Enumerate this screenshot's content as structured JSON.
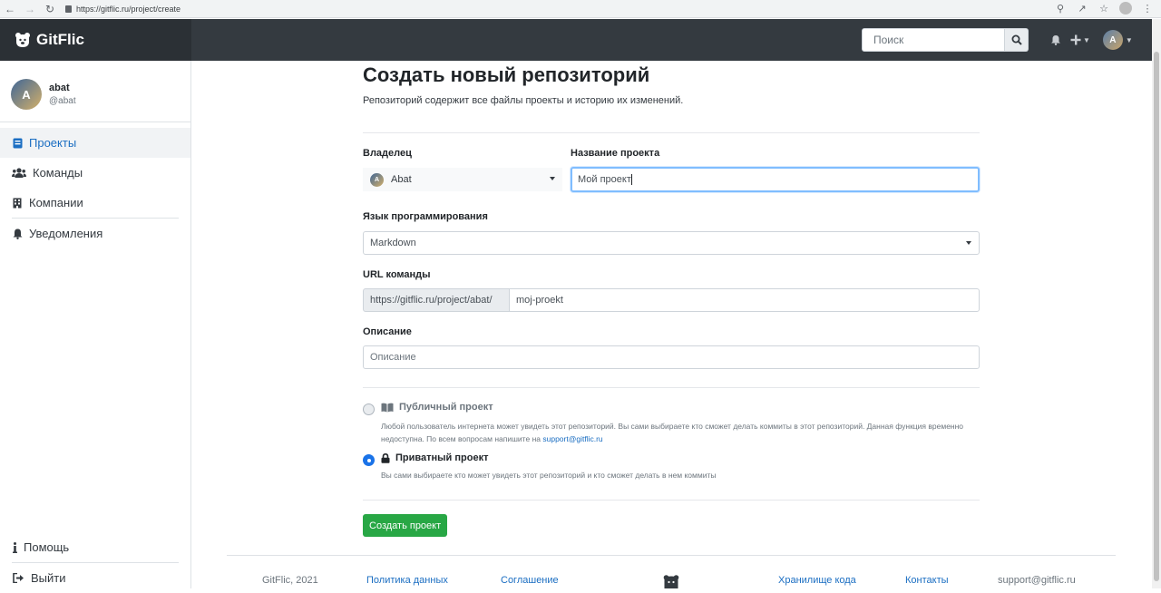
{
  "browser": {
    "url": "https://gitflic.ru/project/create"
  },
  "header": {
    "brand": "GitFlic",
    "search_placeholder": "Поиск"
  },
  "sidebar": {
    "user_name": "abat",
    "user_handle": "@abat",
    "avatar_letter": "A",
    "items": [
      {
        "label": "Проекты",
        "icon": "book-icon"
      },
      {
        "label": "Команды",
        "icon": "users-icon"
      },
      {
        "label": "Компании",
        "icon": "building-icon"
      },
      {
        "label": "Уведомления",
        "icon": "bell-icon"
      }
    ],
    "bottom": [
      {
        "label": "Помощь",
        "icon": "info-icon"
      },
      {
        "label": "Выйти",
        "icon": "sign-out-icon"
      }
    ]
  },
  "form": {
    "title": "Создать новый репозиторий",
    "subtitle": "Репозиторий содержит все файлы проекты и историю их изменений.",
    "owner_label": "Владелец",
    "owner_value": "Abat",
    "name_label": "Название проекта",
    "name_value": "Мой проект",
    "lang_label": "Язык программирования",
    "lang_value": "Markdown",
    "url_label": "URL команды",
    "url_prefix": "https://gitflic.ru/project/abat/",
    "url_value": "moj-proekt",
    "desc_label": "Описание",
    "desc_placeholder": "Описание",
    "public_title": "Публичный проект",
    "public_desc": "Любой пользователь интернета может увидеть этот репозиторий. Вы сами выбираете кто сможет делать коммиты в этот репозиторий. Данная функция временно недоступна. По всем вопросам напишите на",
    "public_email": "support@gitflic.ru",
    "private_title": "Приватный проект",
    "private_desc": "Вы сами выбираете кто может увидеть этот репозиторий и кто сможет делать в нем коммиты",
    "selected_visibility": "private",
    "submit_label": "Создать проект"
  },
  "footer": {
    "copyright": "GitFlic, 2021",
    "privacy": "Политика данных",
    "agreement": "Соглашение",
    "storage": "Хранилище кода",
    "contacts": "Контакты",
    "email": "support@gitflic.ru"
  },
  "colors": {
    "header_bg": "#343a40",
    "accent": "#1b6ec2",
    "success": "#28a745",
    "radio_checked": "#1a73e8"
  }
}
